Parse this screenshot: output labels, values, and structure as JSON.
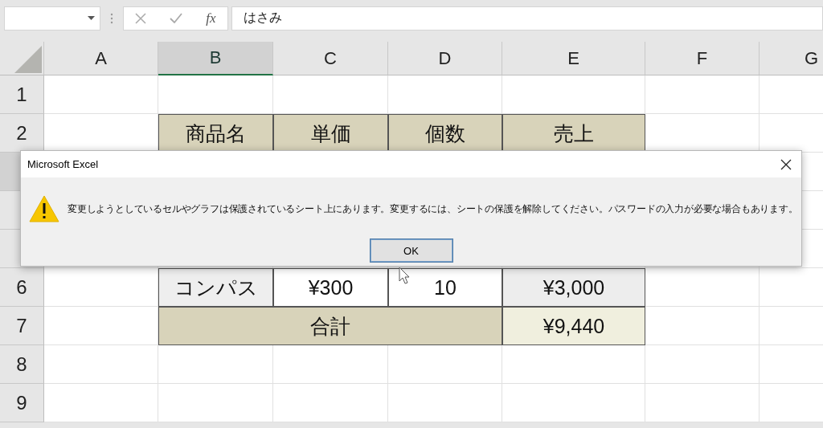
{
  "formula_bar": {
    "function_label": "fx",
    "content": "はさみ"
  },
  "columns": [
    {
      "label": "A",
      "selected": false
    },
    {
      "label": "B",
      "selected": true
    },
    {
      "label": "C",
      "selected": false
    },
    {
      "label": "D",
      "selected": false
    },
    {
      "label": "E",
      "selected": false
    },
    {
      "label": "F",
      "selected": false
    },
    {
      "label": "G",
      "selected": false
    }
  ],
  "rows": [
    {
      "label": "1",
      "selected": false
    },
    {
      "label": "2",
      "selected": false,
      "cells": [
        {
          "kind": "empty"
        },
        {
          "kind": "header",
          "text": "商品名"
        },
        {
          "kind": "header",
          "text": "単価"
        },
        {
          "kind": "header",
          "text": "個数"
        },
        {
          "kind": "header",
          "text": "売上"
        },
        {
          "kind": "empty"
        },
        {
          "kind": "empty"
        }
      ]
    },
    {
      "selected": true
    },
    {
      "selected": false
    },
    {
      "selected": false
    },
    {
      "label": "6",
      "selected": false,
      "cells": [
        {
          "kind": "empty"
        },
        {
          "kind": "name",
          "text": "コンパス"
        },
        {
          "kind": "value",
          "text": "¥300"
        },
        {
          "kind": "value",
          "text": "10"
        },
        {
          "kind": "computed",
          "text": "¥3,000"
        },
        {
          "kind": "empty"
        },
        {
          "kind": "empty"
        }
      ]
    },
    {
      "label": "7",
      "selected": false,
      "cells": [
        {
          "kind": "empty"
        },
        {
          "kind": "total_label",
          "text": "合計"
        },
        {
          "kind": "total_value",
          "text": "¥9,440"
        },
        {
          "kind": "empty"
        },
        {
          "kind": "empty"
        }
      ]
    },
    {
      "label": "8",
      "selected": false
    },
    {
      "label": "9",
      "selected": false
    }
  ],
  "dialog": {
    "title": "Microsoft Excel",
    "message": "変更しようとしているセルやグラフは保護されているシート上にあります。変更するには、シートの保護を解除してください。パスワードの入力が必要な場合もあります。",
    "buttons": [
      "OK"
    ]
  }
}
